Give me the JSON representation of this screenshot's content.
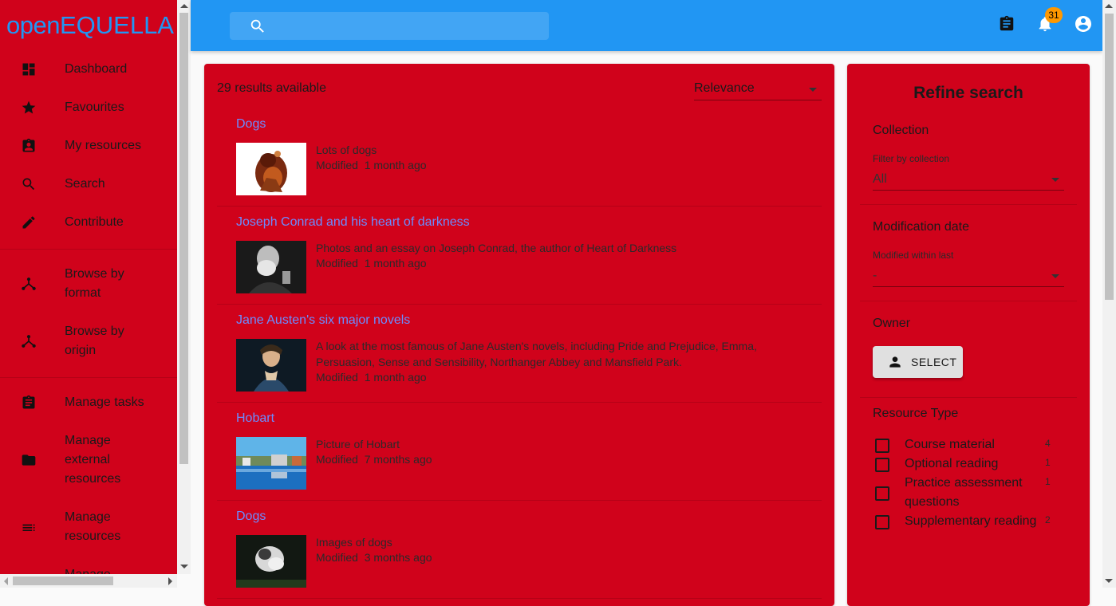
{
  "logo": {
    "prefix": "open",
    "name": "EQUELLA"
  },
  "sidebar": {
    "items": [
      {
        "label": "Dashboard",
        "icon": "dashboard-icon"
      },
      {
        "label": "Favourites",
        "icon": "star-icon"
      },
      {
        "label": "My resources",
        "icon": "assignment-ind-icon"
      },
      {
        "label": "Search",
        "icon": "search-icon"
      },
      {
        "label": "Contribute",
        "icon": "pencil-icon"
      },
      {
        "label": "Browse by format",
        "icon": "hierarchy-icon"
      },
      {
        "label": "Browse by origin",
        "icon": "hierarchy-icon"
      },
      {
        "label": "Manage tasks",
        "icon": "assignment-icon"
      },
      {
        "label": "Manage external resources",
        "icon": "folder-icon"
      },
      {
        "label": "Manage resources",
        "icon": "list-icon"
      },
      {
        "label": "Manage",
        "icon": ""
      }
    ]
  },
  "header": {
    "search_placeholder": "",
    "notification_count": "31",
    "colors": {
      "app_bar": "#2196f3",
      "badge": "#ff9800"
    }
  },
  "results": {
    "count_text": "29 results available",
    "sort_value": "Relevance",
    "items": [
      {
        "title": "Dogs",
        "description": "Lots of dogs",
        "modified_label": "Modified",
        "modified_value": "1 month ago"
      },
      {
        "title": "Joseph Conrad and his heart of darkness",
        "description": "Photos and an essay on Joseph Conrad, the author of Heart of Darkness",
        "modified_label": "Modified",
        "modified_value": "1 month ago"
      },
      {
        "title": "Jane Austen's six major novels",
        "description": "A look at the most famous of Jane Austen's novels, including Pride and Prejudice, Emma, Persuasion, Sense and Sensibility, Northanger Abbey and Mansfield Park.",
        "modified_label": "Modified",
        "modified_value": "1 month ago"
      },
      {
        "title": "Hobart",
        "description": "Picture of Hobart",
        "modified_label": "Modified",
        "modified_value": "7 months ago"
      },
      {
        "title": "Dogs",
        "description": "Images of dogs",
        "modified_label": "Modified",
        "modified_value": "3 months ago"
      }
    ]
  },
  "refine": {
    "title": "Refine search",
    "collection": {
      "heading": "Collection",
      "label": "Filter by collection",
      "value": "All"
    },
    "modification": {
      "heading": "Modification date",
      "label": "Modified within last",
      "value": "-"
    },
    "owner": {
      "heading": "Owner",
      "button_label": "SELECT"
    },
    "resource_type": {
      "heading": "Resource Type",
      "options": [
        {
          "label": "Course material",
          "count": "4"
        },
        {
          "label": "Optional reading",
          "count": "1"
        },
        {
          "label": "Practice assessment questions",
          "count": "1"
        },
        {
          "label": "Supplementary reading",
          "count": "2"
        }
      ]
    }
  },
  "theme": {
    "panel": "#d0021b",
    "link": "#6b8cff"
  }
}
